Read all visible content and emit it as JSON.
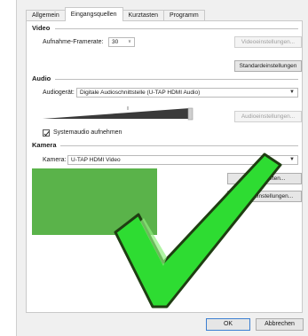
{
  "tabs": [
    "Allgemein",
    "Eingangsquellen",
    "Kurztasten",
    "Programm"
  ],
  "active_tab": 1,
  "video": {
    "title": "Video",
    "framerate_label": "Aufnahme-Framerate:",
    "framerate_value": "30",
    "settings_button": "Videoeinstellungen...",
    "default_button": "Standardeinstellungen"
  },
  "audio": {
    "title": "Audio",
    "device_label": "Audiogerät:",
    "device_value": "Digitale Audioschnittstelle (U-TAP HDMI Audio)",
    "settings_button": "Audioeinstellungen...",
    "system_audio_label": "Systemaudio aufnehmen",
    "system_audio_checked": true
  },
  "camera": {
    "title": "Kamera",
    "device_label": "Kamera:",
    "device_value": "U-TAP HDMI Video",
    "properties_button": "Eigenschaften...",
    "format_button": "Formateinstellungen..."
  },
  "footer": {
    "ok_label": "OK",
    "cancel_label": "Abbrechen"
  },
  "colors": {
    "preview": "#5ab34a",
    "checkmark_fill": "#2edc32",
    "checkmark_stroke": "#1f3d12"
  },
  "overlay_icon": "checkmark-icon"
}
